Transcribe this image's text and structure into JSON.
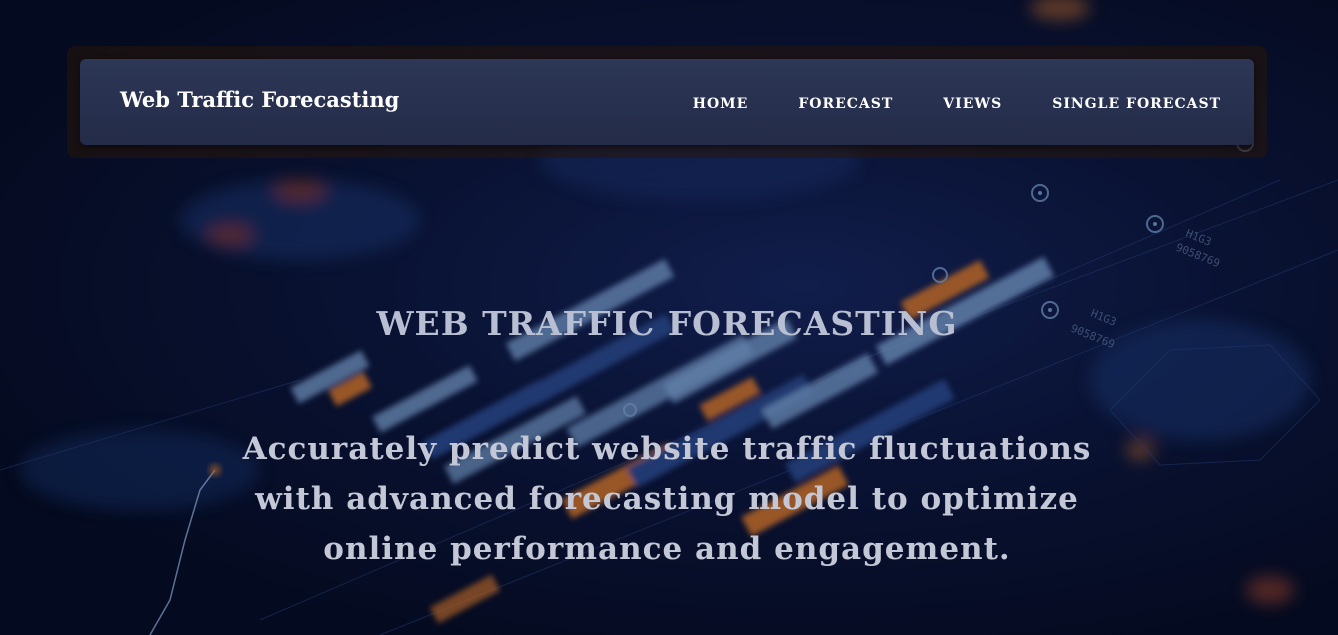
{
  "navbar": {
    "brand": "Web Traffic Forecasting",
    "links": [
      {
        "label": "HOME"
      },
      {
        "label": "FORECAST"
      },
      {
        "label": "VIEWS"
      },
      {
        "label": "SINGLE FORECAST"
      }
    ]
  },
  "hero": {
    "title": "WEB TRAFFIC FORECASTING",
    "subtitle": "Accurately predict website traffic fluctuations with advanced forecasting model to optimize online performance and engagement."
  },
  "background": {
    "image": "blurred-analytics-dashboard-bars",
    "labels": [
      "H1G3",
      "9058769",
      "H1G3",
      "9058769"
    ],
    "colors": {
      "base": "#050a1f",
      "bar_light": "#7fa6d6",
      "bar_dark": "#2a4a8c",
      "accent_orange": "#e07a2a"
    }
  }
}
